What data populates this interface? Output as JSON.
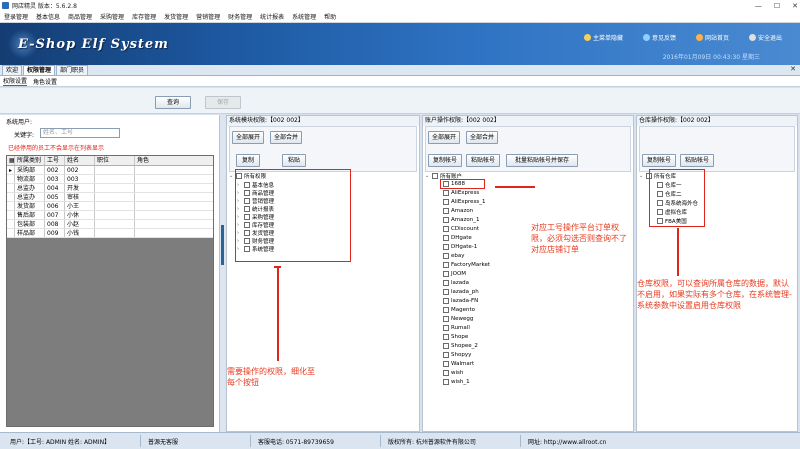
{
  "window": {
    "title": "网店精灵  版本：5.6.2.8"
  },
  "menu": [
    "登录管理",
    "基本信息",
    "商品管理",
    "采购管理",
    "库存管理",
    "发货管理",
    "营销管理",
    "财务管理",
    "统计报表",
    "系统管理",
    "帮助"
  ],
  "banner": {
    "logo": "E-Shop Elf System",
    "links": [
      {
        "label": "主菜单隐藏",
        "icon": "menu-icon"
      },
      {
        "label": "意见反馈",
        "icon": "feedback-icon"
      },
      {
        "label": "网站首页",
        "icon": "home-icon"
      },
      {
        "label": "安全退出",
        "icon": "exit-icon"
      }
    ],
    "datetime": "2016年01月09日 00:43:30 星期三"
  },
  "doc_tabs": [
    "欢迎",
    "权限管理",
    "部门职员"
  ],
  "inner_tabs": [
    "权限设置",
    "角色设置"
  ],
  "toolbar": {
    "query": "查询",
    "save": "保存"
  },
  "left": {
    "title": "系统用户:",
    "keyword_label": "关键字:",
    "keyword_placeholder": "姓名、工号",
    "warning": "已经停用的员工不会显示在列表显示",
    "columns": [
      "所属类别",
      "工号",
      "姓名",
      "职位",
      "角色"
    ],
    "rows": [
      [
        "采购部",
        "002",
        "002",
        "",
        ""
      ],
      [
        "物流部",
        "003",
        "003",
        "",
        ""
      ],
      [
        "总监办",
        "004",
        "开发",
        "",
        ""
      ],
      [
        "总监办",
        "005",
        "审核",
        "",
        ""
      ],
      [
        "发货部",
        "006",
        "小王",
        "",
        ""
      ],
      [
        "售后部",
        "007",
        "小休",
        "",
        ""
      ],
      [
        "包装部",
        "008",
        "小赵",
        "",
        ""
      ],
      [
        "样品部",
        "009",
        "小钱",
        "",
        ""
      ]
    ]
  },
  "module_panel": {
    "title": "系统模块权限:【002 002】",
    "buttons": [
      "全部展开",
      "全部合并",
      "复制",
      "粘贴"
    ],
    "root": "所有权限",
    "items": [
      "基本信息",
      "商品管理",
      "营销管理",
      "统计报表",
      "采购管理",
      "库存管理",
      "发货管理",
      "财务管理",
      "系统管理"
    ],
    "annotation": "需要操作的权限，细化至每个按钮"
  },
  "account_panel": {
    "title": "账户操作权限:【002 002】",
    "buttons": [
      "全部展开",
      "全部合并",
      "复制帐号",
      "粘贴帐号",
      "批量粘贴帐号并保存"
    ],
    "root": "所有账户",
    "items": [
      "1688",
      "AliExpress",
      "AliExpress_1",
      "Amazon",
      "Amazon_1",
      "CDiscount",
      "DHgate",
      "DHgate-1",
      "ebay",
      "FactoryMarket",
      "JOOM",
      "lazada",
      "lazada_ph",
      "lazada-FN",
      "Magento",
      "Newegg",
      "Rumall",
      "Shope",
      "Shopee_2",
      "Shopyy",
      "Walmart",
      "wish",
      "wish_1"
    ],
    "annotation": "对应工号操作平台订单权限，必须勾选否则查询不了对应店铺订单"
  },
  "warehouse_panel": {
    "title": "仓库操作权限:【002 002】",
    "buttons": [
      "复制帐号",
      "粘贴帐号"
    ],
    "root": "所有仓库",
    "items": [
      "仓库一",
      "仓库二",
      "岛系统海外仓",
      "虚拟仓库",
      "FBA美国"
    ],
    "annotation": "仓库权限，可以查询所属仓库的数据，默认不启用，如果实际有多个仓库，在系统管理-系统参数中设置启用仓库权限"
  },
  "status": {
    "user": "用户:【工号: ADMIN  姓名: ADMIN】",
    "edition": "普源无客服",
    "phone": "客服电话: 0571-89739659",
    "copyright": "版权所有: 杭州普源软件有限公司",
    "website": "网址: http://www.allroot.cn"
  },
  "colors": {
    "annotation_red": "#e0261a",
    "banner_blue": "#1e5aa3"
  }
}
